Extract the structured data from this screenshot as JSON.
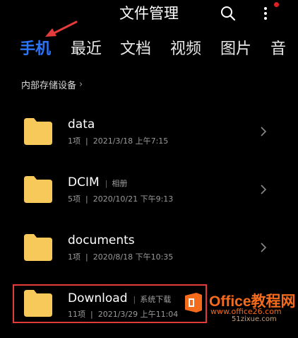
{
  "header": {
    "title": "文件管理",
    "search_icon": "search-icon",
    "more_icon": "more-vertical-icon",
    "notification_color": "#e02020"
  },
  "tabs": [
    {
      "label": "手机",
      "active": true
    },
    {
      "label": "最近",
      "active": false
    },
    {
      "label": "文档",
      "active": false
    },
    {
      "label": "视频",
      "active": false
    },
    {
      "label": "图片",
      "active": false
    },
    {
      "label": "音",
      "active": false
    }
  ],
  "accent_color": "#2b74f5",
  "section": {
    "label": "内部存储设备"
  },
  "folders": [
    {
      "name": "data",
      "tag": "",
      "count": "1项",
      "date": "2021/3/18 上午7:15"
    },
    {
      "name": "DCIM",
      "tag": "相册",
      "count": "5项",
      "date": "2020/10/21 下午9:13"
    },
    {
      "name": "documents",
      "tag": "",
      "count": "1项",
      "date": "2020/8/18 下午10:35"
    },
    {
      "name": "Download",
      "tag": "系统下载",
      "count": "11项",
      "date": "2021/3/29 上午11:04"
    }
  ],
  "watermark": {
    "brand": "Office教程网",
    "url": "www.office26.com",
    "sub": "51zixue.com"
  }
}
